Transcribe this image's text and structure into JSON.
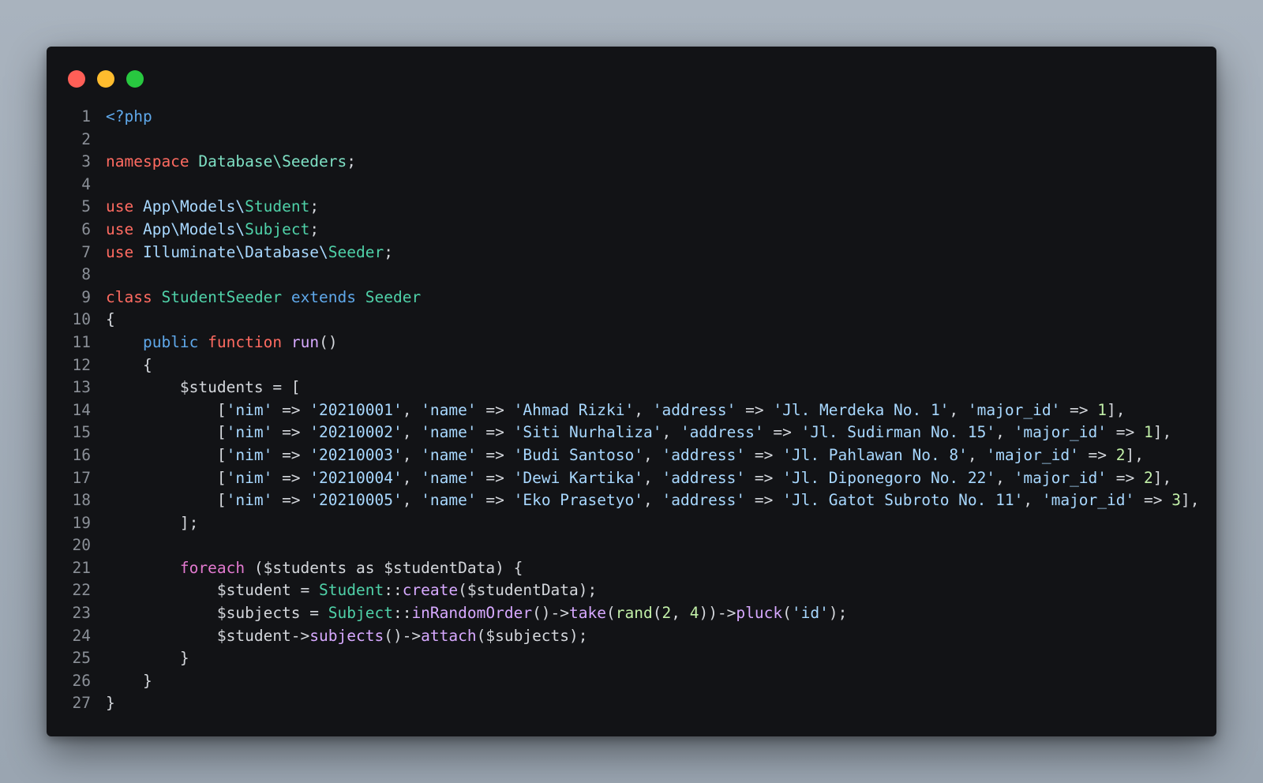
{
  "window": {
    "traffic_lights": [
      {
        "name": "close",
        "color": "#ff5f57"
      },
      {
        "name": "minimize",
        "color": "#febc2e"
      },
      {
        "name": "maximize",
        "color": "#28c840"
      }
    ]
  },
  "colors": {
    "background": "#121316",
    "keyword": "#ff6b61",
    "class": "#4fd1a8",
    "string": "#a8d8ff",
    "number": "#c2f0a8",
    "function": "#d7a9ff",
    "control": "#e37ad0",
    "tag": "#5fa8ea",
    "line_number": "#8b9098"
  },
  "code": {
    "language": "php",
    "lines": [
      [
        {
          "t": "tag",
          "v": "<?php"
        }
      ],
      [],
      [
        {
          "t": "kw",
          "v": "namespace"
        },
        {
          "t": "plain",
          "v": " "
        },
        {
          "t": "ns",
          "v": "Database\\Seeders"
        },
        {
          "t": "plain",
          "v": ";"
        }
      ],
      [],
      [
        {
          "t": "kw",
          "v": "use"
        },
        {
          "t": "plain",
          "v": " "
        },
        {
          "t": "path",
          "v": "App\\Models\\"
        },
        {
          "t": "cls",
          "v": "Student"
        },
        {
          "t": "plain",
          "v": ";"
        }
      ],
      [
        {
          "t": "kw",
          "v": "use"
        },
        {
          "t": "plain",
          "v": " "
        },
        {
          "t": "path",
          "v": "App\\Models\\"
        },
        {
          "t": "cls",
          "v": "Subject"
        },
        {
          "t": "plain",
          "v": ";"
        }
      ],
      [
        {
          "t": "kw",
          "v": "use"
        },
        {
          "t": "plain",
          "v": " "
        },
        {
          "t": "path",
          "v": "Illuminate\\Database\\"
        },
        {
          "t": "cls",
          "v": "Seeder"
        },
        {
          "t": "plain",
          "v": ";"
        }
      ],
      [],
      [
        {
          "t": "kw",
          "v": "class"
        },
        {
          "t": "plain",
          "v": " "
        },
        {
          "t": "cls",
          "v": "StudentSeeder"
        },
        {
          "t": "plain",
          "v": " "
        },
        {
          "t": "ext",
          "v": "extends"
        },
        {
          "t": "plain",
          "v": " "
        },
        {
          "t": "cls",
          "v": "Seeder"
        }
      ],
      [
        {
          "t": "plain",
          "v": "{"
        }
      ],
      [
        {
          "t": "plain",
          "v": "    "
        },
        {
          "t": "pub",
          "v": "public"
        },
        {
          "t": "plain",
          "v": " "
        },
        {
          "t": "kw",
          "v": "function"
        },
        {
          "t": "plain",
          "v": " "
        },
        {
          "t": "fn",
          "v": "run"
        },
        {
          "t": "plain",
          "v": "()"
        }
      ],
      [
        {
          "t": "plain",
          "v": "    {"
        }
      ],
      [
        {
          "t": "plain",
          "v": "        $students = ["
        }
      ],
      [
        {
          "t": "plain",
          "v": "            ["
        },
        {
          "t": "str",
          "v": "'nim'"
        },
        {
          "t": "plain",
          "v": " => "
        },
        {
          "t": "str",
          "v": "'20210001'"
        },
        {
          "t": "plain",
          "v": ", "
        },
        {
          "t": "str",
          "v": "'name'"
        },
        {
          "t": "plain",
          "v": " => "
        },
        {
          "t": "str",
          "v": "'Ahmad Rizki'"
        },
        {
          "t": "plain",
          "v": ", "
        },
        {
          "t": "str",
          "v": "'address'"
        },
        {
          "t": "plain",
          "v": " => "
        },
        {
          "t": "str",
          "v": "'Jl. Merdeka No. 1'"
        },
        {
          "t": "plain",
          "v": ", "
        },
        {
          "t": "str",
          "v": "'major_id'"
        },
        {
          "t": "plain",
          "v": " => "
        },
        {
          "t": "num",
          "v": "1"
        },
        {
          "t": "plain",
          "v": "],"
        }
      ],
      [
        {
          "t": "plain",
          "v": "            ["
        },
        {
          "t": "str",
          "v": "'nim'"
        },
        {
          "t": "plain",
          "v": " => "
        },
        {
          "t": "str",
          "v": "'20210002'"
        },
        {
          "t": "plain",
          "v": ", "
        },
        {
          "t": "str",
          "v": "'name'"
        },
        {
          "t": "plain",
          "v": " => "
        },
        {
          "t": "str",
          "v": "'Siti Nurhaliza'"
        },
        {
          "t": "plain",
          "v": ", "
        },
        {
          "t": "str",
          "v": "'address'"
        },
        {
          "t": "plain",
          "v": " => "
        },
        {
          "t": "str",
          "v": "'Jl. Sudirman No. 15'"
        },
        {
          "t": "plain",
          "v": ", "
        },
        {
          "t": "str",
          "v": "'major_id'"
        },
        {
          "t": "plain",
          "v": " => "
        },
        {
          "t": "num",
          "v": "1"
        },
        {
          "t": "plain",
          "v": "],"
        }
      ],
      [
        {
          "t": "plain",
          "v": "            ["
        },
        {
          "t": "str",
          "v": "'nim'"
        },
        {
          "t": "plain",
          "v": " => "
        },
        {
          "t": "str",
          "v": "'20210003'"
        },
        {
          "t": "plain",
          "v": ", "
        },
        {
          "t": "str",
          "v": "'name'"
        },
        {
          "t": "plain",
          "v": " => "
        },
        {
          "t": "str",
          "v": "'Budi Santoso'"
        },
        {
          "t": "plain",
          "v": ", "
        },
        {
          "t": "str",
          "v": "'address'"
        },
        {
          "t": "plain",
          "v": " => "
        },
        {
          "t": "str",
          "v": "'Jl. Pahlawan No. 8'"
        },
        {
          "t": "plain",
          "v": ", "
        },
        {
          "t": "str",
          "v": "'major_id'"
        },
        {
          "t": "plain",
          "v": " => "
        },
        {
          "t": "num",
          "v": "2"
        },
        {
          "t": "plain",
          "v": "],"
        }
      ],
      [
        {
          "t": "plain",
          "v": "            ["
        },
        {
          "t": "str",
          "v": "'nim'"
        },
        {
          "t": "plain",
          "v": " => "
        },
        {
          "t": "str",
          "v": "'20210004'"
        },
        {
          "t": "plain",
          "v": ", "
        },
        {
          "t": "str",
          "v": "'name'"
        },
        {
          "t": "plain",
          "v": " => "
        },
        {
          "t": "str",
          "v": "'Dewi Kartika'"
        },
        {
          "t": "plain",
          "v": ", "
        },
        {
          "t": "str",
          "v": "'address'"
        },
        {
          "t": "plain",
          "v": " => "
        },
        {
          "t": "str",
          "v": "'Jl. Diponegoro No. 22'"
        },
        {
          "t": "plain",
          "v": ", "
        },
        {
          "t": "str",
          "v": "'major_id'"
        },
        {
          "t": "plain",
          "v": " => "
        },
        {
          "t": "num",
          "v": "2"
        },
        {
          "t": "plain",
          "v": "],"
        }
      ],
      [
        {
          "t": "plain",
          "v": "            ["
        },
        {
          "t": "str",
          "v": "'nim'"
        },
        {
          "t": "plain",
          "v": " => "
        },
        {
          "t": "str",
          "v": "'20210005'"
        },
        {
          "t": "plain",
          "v": ", "
        },
        {
          "t": "str",
          "v": "'name'"
        },
        {
          "t": "plain",
          "v": " => "
        },
        {
          "t": "str",
          "v": "'Eko Prasetyo'"
        },
        {
          "t": "plain",
          "v": ", "
        },
        {
          "t": "str",
          "v": "'address'"
        },
        {
          "t": "plain",
          "v": " => "
        },
        {
          "t": "str",
          "v": "'Jl. Gatot Subroto No. 11'"
        },
        {
          "t": "plain",
          "v": ", "
        },
        {
          "t": "str",
          "v": "'major_id'"
        },
        {
          "t": "plain",
          "v": " => "
        },
        {
          "t": "num",
          "v": "3"
        },
        {
          "t": "plain",
          "v": "],"
        }
      ],
      [
        {
          "t": "plain",
          "v": "        ];"
        }
      ],
      [],
      [
        {
          "t": "plain",
          "v": "        "
        },
        {
          "t": "ctl",
          "v": "foreach"
        },
        {
          "t": "plain",
          "v": " ($students as $studentData) {"
        }
      ],
      [
        {
          "t": "plain",
          "v": "            $student = "
        },
        {
          "t": "cls",
          "v": "Student"
        },
        {
          "t": "plain",
          "v": "::"
        },
        {
          "t": "fn",
          "v": "create"
        },
        {
          "t": "plain",
          "v": "($studentData);"
        }
      ],
      [
        {
          "t": "plain",
          "v": "            $subjects = "
        },
        {
          "t": "cls",
          "v": "Subject"
        },
        {
          "t": "plain",
          "v": "::"
        },
        {
          "t": "fn",
          "v": "inRandomOrder"
        },
        {
          "t": "plain",
          "v": "()->"
        },
        {
          "t": "fn",
          "v": "take"
        },
        {
          "t": "plain",
          "v": "("
        },
        {
          "t": "num2",
          "v": "rand"
        },
        {
          "t": "plain",
          "v": "("
        },
        {
          "t": "num",
          "v": "2"
        },
        {
          "t": "plain",
          "v": ", "
        },
        {
          "t": "num",
          "v": "4"
        },
        {
          "t": "plain",
          "v": "))->"
        },
        {
          "t": "fn",
          "v": "pluck"
        },
        {
          "t": "plain",
          "v": "("
        },
        {
          "t": "str",
          "v": "'id'"
        },
        {
          "t": "plain",
          "v": ");"
        }
      ],
      [
        {
          "t": "plain",
          "v": "            $student->"
        },
        {
          "t": "fn",
          "v": "subjects"
        },
        {
          "t": "plain",
          "v": "()->"
        },
        {
          "t": "fn",
          "v": "attach"
        },
        {
          "t": "plain",
          "v": "($subjects);"
        }
      ],
      [
        {
          "t": "plain",
          "v": "        }"
        }
      ],
      [
        {
          "t": "plain",
          "v": "    }"
        }
      ],
      [
        {
          "t": "plain",
          "v": "}"
        }
      ]
    ]
  }
}
